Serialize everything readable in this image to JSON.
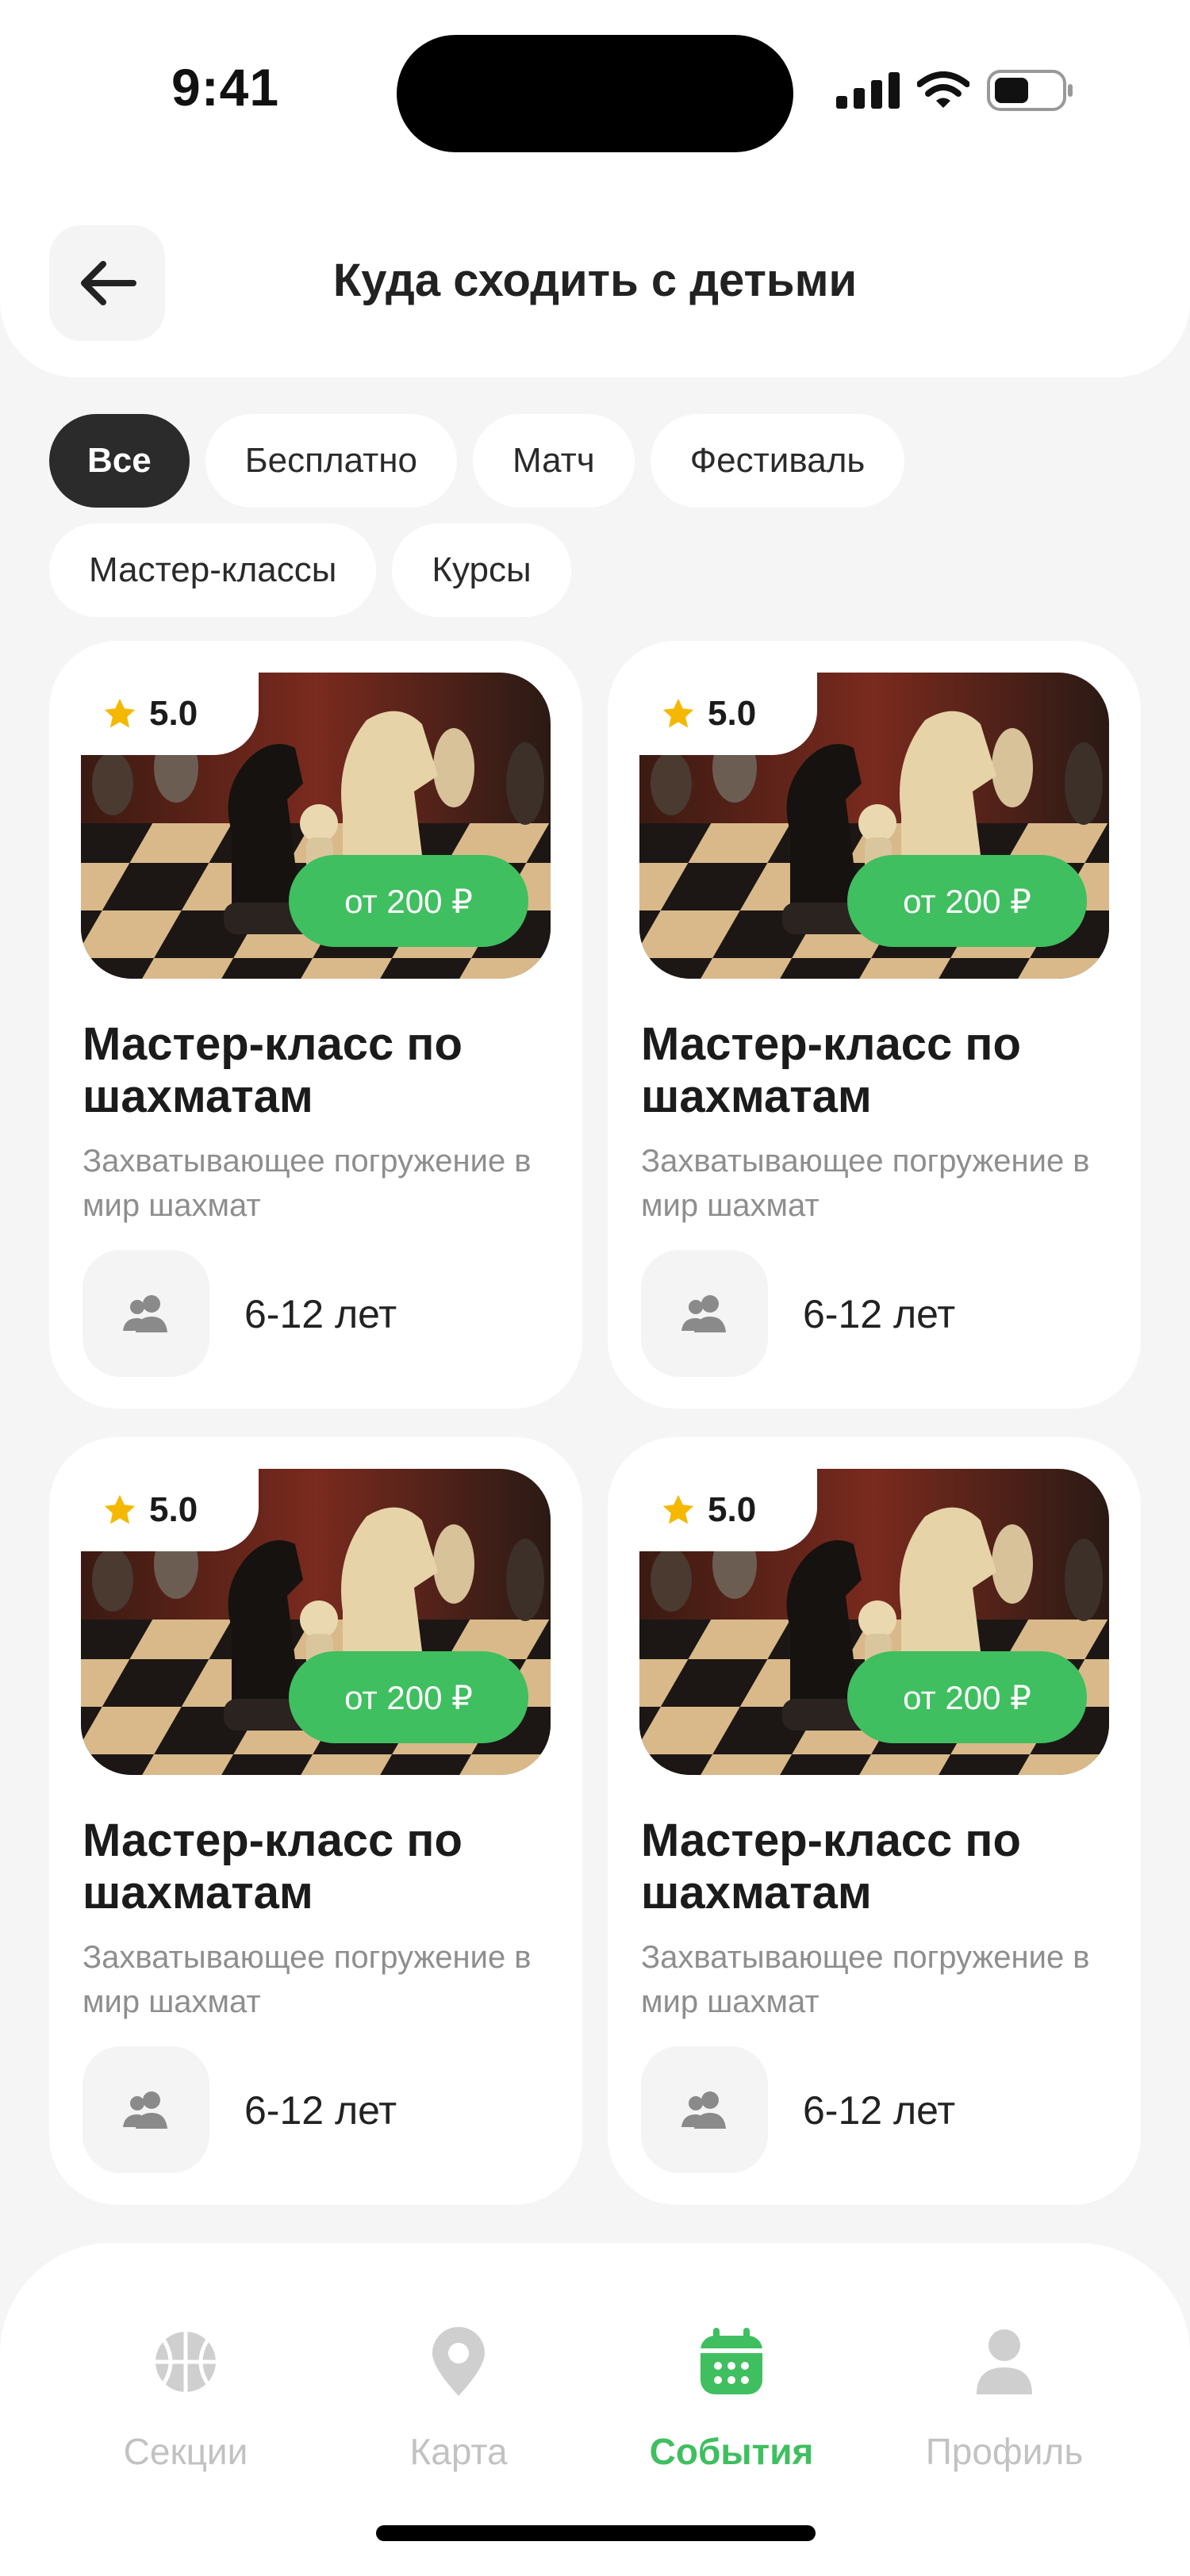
{
  "status_bar": {
    "time": "9:41"
  },
  "header": {
    "title": "Куда сходить с детьми"
  },
  "filters": [
    {
      "label": "Все",
      "active": true
    },
    {
      "label": "Бесплатно",
      "active": false
    },
    {
      "label": "Матч",
      "active": false
    },
    {
      "label": "Фестиваль",
      "active": false
    },
    {
      "label": "Мастер-классы",
      "active": false
    },
    {
      "label": "Курсы",
      "active": false
    }
  ],
  "cards": [
    {
      "rating": "5.0",
      "price": "от 200 ₽",
      "title": "Мастер-класс по шахматам",
      "description": "Захватывающее погружение в мир шахмат",
      "age": "6-12 лет"
    },
    {
      "rating": "5.0",
      "price": "от 200 ₽",
      "title": "Мастер-класс по шахматам",
      "description": "Захватывающее погружение в мир шахмат",
      "age": "6-12 лет"
    },
    {
      "rating": "5.0",
      "price": "от 200 ₽",
      "title": "Мастер-класс по шахматам",
      "description": "Захватывающее погружение в мир шахмат",
      "age": "6-12 лет"
    },
    {
      "rating": "5.0",
      "price": "от 200 ₽",
      "title": "Мастер-класс по шахматам",
      "description": "Захватывающее погружение в мир шахмат",
      "age": "6-12 лет"
    }
  ],
  "bottom_nav": [
    {
      "label": "Секции",
      "icon": "basketball-icon",
      "active": false
    },
    {
      "label": "Карта",
      "icon": "map-pin-icon",
      "active": false
    },
    {
      "label": "События",
      "icon": "calendar-icon",
      "active": true
    },
    {
      "label": "Профиль",
      "icon": "profile-icon",
      "active": false
    }
  ],
  "colors": {
    "accent": "#3fbf5f",
    "chip_active": "#2b2b2b",
    "background": "#f5f5f5",
    "star": "#f5b800"
  }
}
